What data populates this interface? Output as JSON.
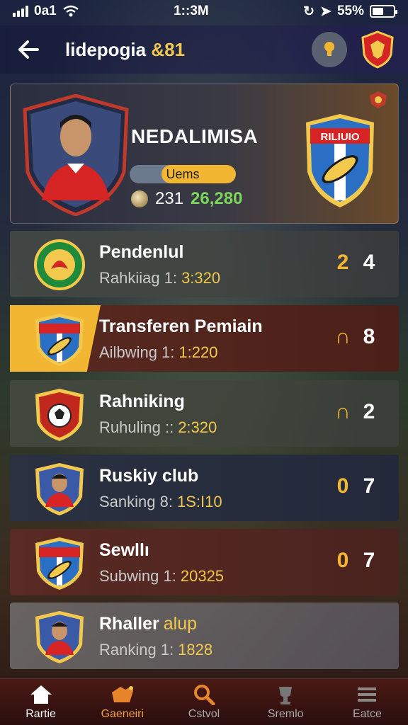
{
  "status_bar": {
    "carrier": "0a1",
    "time": "1::3M",
    "battery": "55%",
    "battery_level": 0.55
  },
  "header": {
    "title": "lidepogia",
    "title_accent": "&81"
  },
  "profile": {
    "name": "NEDALIMISA",
    "badge_label": "Uems",
    "level_progress": 0.7,
    "stat_a": "231",
    "stat_b": "26,280",
    "team_crest_text": "RILIUIO"
  },
  "rows": [
    {
      "name": "Pendenlul",
      "sub_label": "Rahkiiag 1:",
      "sub_value": "3:320",
      "score_a": "2",
      "score_b": "4",
      "crest": "green-eagle",
      "highlight": false
    },
    {
      "name": "Transferen Pemiain",
      "sub_label": "Ailbwing 1:",
      "sub_value": "1:220",
      "score_a": "∩",
      "score_b": "8",
      "crest": "rilio-shield",
      "highlight": true
    },
    {
      "name": "Rahniking",
      "sub_label": "Ruhuling ::",
      "sub_value": "2:320",
      "score_a": "∩",
      "score_b": "2",
      "crest": "football-shield",
      "highlight": false
    },
    {
      "name": "Ruskiy club",
      "sub_label": "Sanking 8:",
      "sub_value": "1S:I10",
      "score_a": "0",
      "score_b": "7",
      "crest": "player-portrait",
      "highlight": false
    },
    {
      "name": "Sewllı",
      "sub_label": "Subwing 1:",
      "sub_value": "20325",
      "score_a": "0",
      "score_b": "7",
      "crest": "rilio-shield",
      "highlight": false
    },
    {
      "name": "Rhaller",
      "name_accent": "alup",
      "sub_label": "Ranking 1:",
      "sub_value": "1828",
      "score_a": "",
      "score_b": "",
      "crest": "player-portrait",
      "highlight": false
    }
  ],
  "nav": [
    {
      "label": "Rartie",
      "icon": "home-icon"
    },
    {
      "label": "Gaeneiri",
      "icon": "shop-icon"
    },
    {
      "label": "Cstvol",
      "icon": "search-icon"
    },
    {
      "label": "Sremlo",
      "icon": "trophy-icon"
    },
    {
      "label": "Eatce",
      "icon": "menu-icon"
    }
  ],
  "colors": {
    "accent": "#f2b632",
    "green": "#7bd65a",
    "nav_bg": "#4a1a14"
  }
}
